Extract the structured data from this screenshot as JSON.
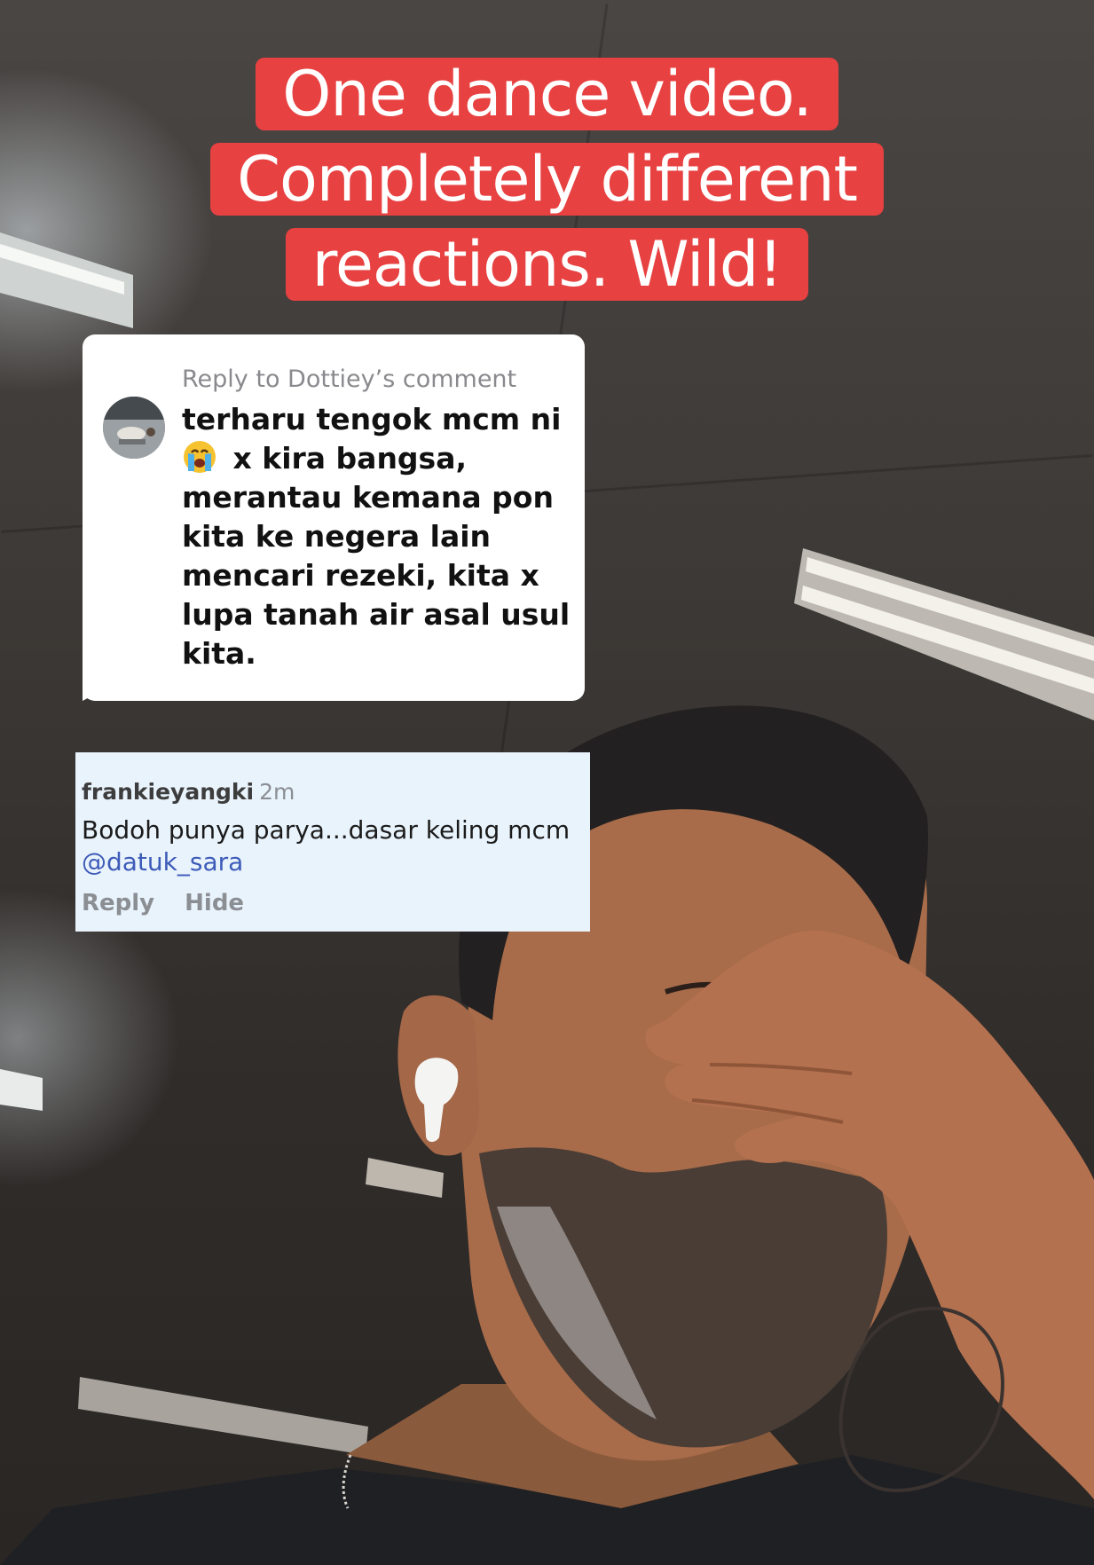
{
  "headline": {
    "line1": "One dance video.",
    "line2": "Completely different",
    "line3": "reactions. Wild!",
    "highlight_color": "#e84141"
  },
  "reply_bubble": {
    "header": "Reply to Dottiey’s comment",
    "text_before_emoji": "terharu tengok mcm ni",
    "emoji": "loudly-crying-face",
    "text_after_emoji": " x kira bangsa, merantau kemana pon kita ke negera lain mencari rezeki, kita x lupa tanah air asal usul kita."
  },
  "comment": {
    "username": "frankieyangki",
    "time": "2m",
    "body": "Bodoh punya parya...dasar keling mcm",
    "mention": "@datuk_sara",
    "reply_label": "Reply",
    "hide_label": "Hide",
    "background_color": "#e9f3fc",
    "mention_color": "#3d5bb8"
  }
}
